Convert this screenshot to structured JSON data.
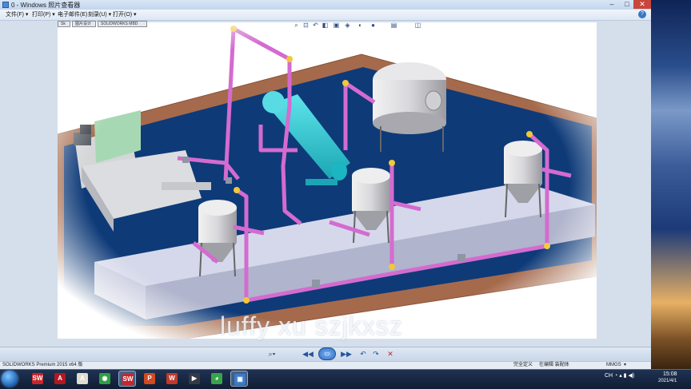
{
  "window": {
    "title": "0 - Windows 照片查看器",
    "controls": {
      "minimize": "–",
      "maximize": "□",
      "close": "✕"
    }
  },
  "menu": {
    "items": [
      {
        "label": "文件(F) ▾"
      },
      {
        "label": "打印(P) ▾"
      },
      {
        "label": "电子邮件(E)"
      },
      {
        "label": "刻录(U) ▾"
      },
      {
        "label": "打开(O) ▾"
      }
    ],
    "help_label": "?"
  },
  "embedded_app": {
    "tabs": [
      "Sk",
      "图片设计",
      "SOLIDWORKS MBD"
    ],
    "toolbar_icons": [
      "zoom-icon",
      "zoom-area-icon",
      "previous-view-icon",
      "section-view-icon",
      "view-orientation-icon",
      "display-style-icon",
      "hide-show-icon",
      "edit-appearance-icon",
      "scene-icon",
      "display-manager-icon"
    ],
    "toolbar_glyphs": [
      "⌕",
      "⊡",
      "↶",
      "◧",
      "▣",
      "◈",
      "◐",
      "●",
      "▤",
      "◫"
    ],
    "status_left": "SOLIDWORKS Premium 2015 x64 版",
    "status_mid": "完全定义",
    "status_mid2": "在编辑 装配体",
    "status_units": "MMGS",
    "status_caret": "▾"
  },
  "watermark": "luffy xu szjkxsz",
  "viewer_controls": {
    "zoom": "⌕▾",
    "prev": "◀◀",
    "slideshow": "▭",
    "next": "▶▶",
    "rotate_ccw": "↶",
    "rotate_cw": "↷",
    "delete": "✕"
  },
  "taskbar": {
    "apps": [
      {
        "name": "solidworks",
        "glyph": "SW",
        "color": "#c8262c",
        "active": false
      },
      {
        "name": "acrobat",
        "glyph": "A",
        "color": "#b3171f",
        "active": false
      },
      {
        "name": "pdf-tool",
        "glyph": "A",
        "color": "#e0dccf",
        "active": false
      },
      {
        "name": "chrome",
        "glyph": "◉",
        "color": "#2f9e44",
        "active": false
      },
      {
        "name": "solidworks-2",
        "glyph": "SW",
        "color": "#c8262c",
        "active": true
      },
      {
        "name": "powerpoint",
        "glyph": "P",
        "color": "#d04a22",
        "active": false
      },
      {
        "name": "app-wx",
        "glyph": "W",
        "color": "#c0392b",
        "active": false
      },
      {
        "name": "video",
        "glyph": "▶",
        "color": "#333a45",
        "active": false
      },
      {
        "name": "wechat",
        "glyph": "◕",
        "color": "#3aa34a",
        "active": false
      },
      {
        "name": "photo-viewer",
        "glyph": "▣",
        "color": "#3d7bc8",
        "active": true
      }
    ],
    "tray_text": "CH ◔ ▴ ▮ ◀)",
    "time": "15:08",
    "date": "2021/4/1"
  }
}
